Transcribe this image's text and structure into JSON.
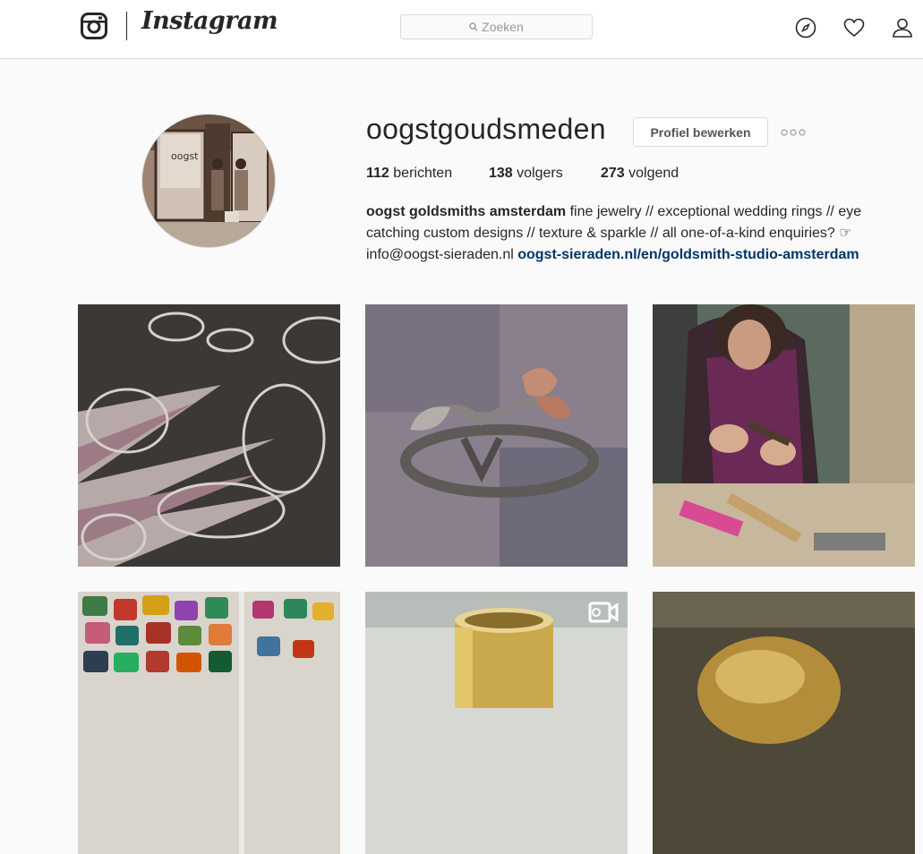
{
  "nav": {
    "brand": "Instagram",
    "search_placeholder": "Zoeken",
    "icons": [
      "instagram-glyph",
      "explore-compass-icon",
      "heart-icon",
      "profile-person-icon"
    ]
  },
  "profile": {
    "username": "oogstgoudsmeden",
    "edit_button": "Profiel bewerken",
    "posts_count": "112",
    "posts_label": "berichten",
    "followers_count": "138",
    "followers_label": "volgers",
    "following_count": "273",
    "following_label": "volgend",
    "bio_name": "oogst goldsmiths amsterdam",
    "bio_text": " fine jewelry // exceptional wedding rings // eye catching custom designs // texture & sparkle // all one-of-a-kind enquiries? ☞ info@oogst-sieraden.nl ",
    "bio_link": "oogst-sieraden.nl/en/goldsmith-studio-amsterdam"
  },
  "colors": {
    "link": "#003569",
    "border": "#dbdbdb",
    "background": "#fafafa"
  }
}
